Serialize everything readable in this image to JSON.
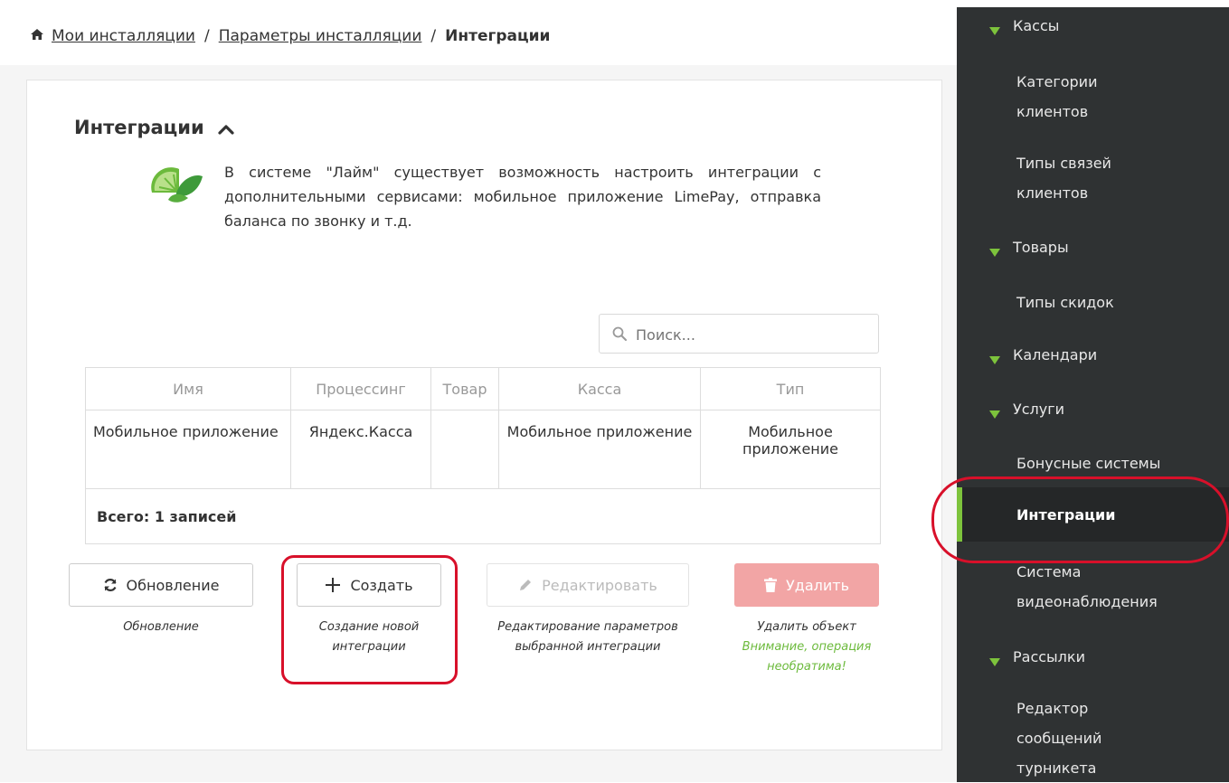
{
  "breadcrumb": {
    "items": [
      "Мои инсталляции",
      "Параметры инсталляции"
    ],
    "separator": "/",
    "current": "Интеграции"
  },
  "card": {
    "title": "Интеграции",
    "description": "В системе \"Лайм\" существует возможность настроить интеграции с дополнительными сервисами: мобильное приложение LimePay, отправка баланса по звонку и т.д."
  },
  "search": {
    "placeholder": "Поиск..."
  },
  "table": {
    "columns": [
      "Имя",
      "Процессинг",
      "Товар",
      "Касса",
      "Тип"
    ],
    "rows": [
      {
        "name": "Мобильное приложение",
        "processing": "Яндекс.Касса",
        "product": "",
        "cashbox": "Мобильное приложение",
        "type": "Мобильное приложение"
      }
    ],
    "total": "Всего: 1 записей"
  },
  "buttons": {
    "refresh": {
      "label": "Обновление",
      "hint": "Обновление"
    },
    "create": {
      "label": "Создать",
      "hint": "Создание новой интеграции"
    },
    "edit": {
      "label": "Редактировать",
      "hint": "Редактирование параметров выбранной интеграции"
    },
    "delete": {
      "label": "Удалить",
      "hint": "Удалить объект",
      "warning": "Внимание, операция необратима!"
    }
  },
  "sidebar": {
    "items": [
      {
        "label": "Кассы",
        "kind": "category"
      },
      {
        "label": "Категории клиентов",
        "kind": "item"
      },
      {
        "label": "Типы связей клиентов",
        "kind": "item"
      },
      {
        "label": "Товары",
        "kind": "category"
      },
      {
        "label": "Типы скидок",
        "kind": "item"
      },
      {
        "label": "Календари",
        "kind": "category"
      },
      {
        "label": "Услуги",
        "kind": "category"
      },
      {
        "label": "Бонусные системы",
        "kind": "item"
      },
      {
        "label": "Интеграции",
        "kind": "item-active"
      },
      {
        "label": "Система видеонаблюдения",
        "kind": "item"
      },
      {
        "label": "Рассылки",
        "kind": "category"
      },
      {
        "label": "Редактор сообщений турникета",
        "kind": "item"
      }
    ]
  },
  "colors": {
    "accent_green": "#7dc33c",
    "highlight_red": "#d8102a",
    "sidebar_bg": "#2f3233",
    "delete_bg": "#f2a5a5",
    "warning_text": "#6cba3c"
  },
  "icons": [
    "home-icon",
    "chevron-up-icon",
    "lime-logo-icon",
    "search-icon",
    "refresh-icon",
    "plus-icon",
    "pencil-icon",
    "trash-icon",
    "caret-down-icon"
  ]
}
